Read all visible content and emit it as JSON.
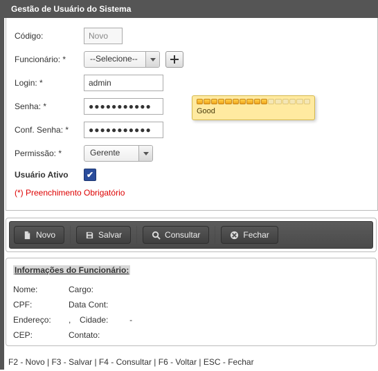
{
  "panel": {
    "title": "Gestão de Usuário do Sistema"
  },
  "fields": {
    "codigo": {
      "label": "Código:",
      "value": "Novo"
    },
    "funcionario": {
      "label": "Funcionário: *",
      "value": "--Selecione--"
    },
    "login": {
      "label": "Login: *",
      "value": "admin"
    },
    "senha": {
      "label": "Senha: *",
      "value": "●●●●●●●●●●●"
    },
    "conf_senha": {
      "label": "Conf. Senha: *",
      "value": "●●●●●●●●●●●"
    },
    "permissao": {
      "label": "Permissão: *",
      "value": "Gerente"
    },
    "ativo": {
      "label": "Usuário Ativo",
      "checked": true
    }
  },
  "password_meter": {
    "text": "Good",
    "filled": 10,
    "total": 16
  },
  "required_note": "(*) Preenchimento Obrigatório",
  "toolbar": {
    "novo": "Novo",
    "salvar": "Salvar",
    "consultar": "Consultar",
    "fechar": "Fechar"
  },
  "info": {
    "title": "Informações do Funcionário:",
    "nome_label": "Nome:",
    "cargo_label": "Cargo:",
    "cpf_label": "CPF:",
    "datacont_label": "Data Cont:",
    "endereco_label": "Endereço:",
    "endereco_value": ",",
    "cidade_label": "Cidade:",
    "cidade_value": "-",
    "cep_label": "CEP:",
    "contato_label": "Contato:"
  },
  "footer": "F2 - Novo | F3 - Salvar | F4 - Consultar | F6 - Voltar | ESC - Fechar"
}
